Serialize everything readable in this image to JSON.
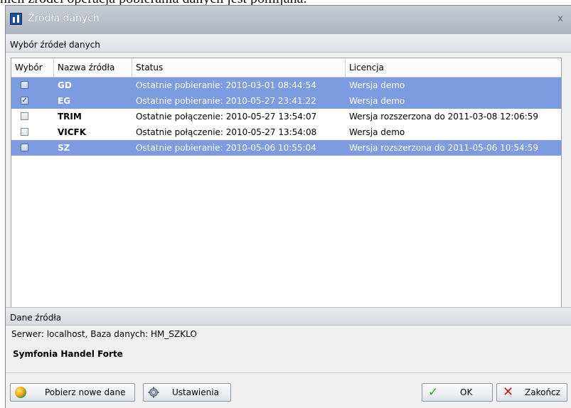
{
  "background_caption": "nich źródeł operacja pobierania danych jest pomijana.",
  "window": {
    "title": "Źródła danych",
    "close_glyph": "x"
  },
  "sources_section": {
    "label": "Wybór źródeł danych"
  },
  "table": {
    "columns": [
      "Wybór",
      "Nazwa źródła",
      "Status",
      "Licencja"
    ],
    "rows": [
      {
        "checked": false,
        "selected": true,
        "name": "GD",
        "status": "Ostatnie pobieranie: 2010-03-01 08:44:54",
        "license": "Wersja demo"
      },
      {
        "checked": true,
        "selected": true,
        "name": "EG",
        "status": "Ostatnie pobieranie: 2010-05-27 23:41:22",
        "license": "Wersja demo"
      },
      {
        "checked": false,
        "selected": false,
        "name": "TRIM",
        "status": "Ostatnie połączenie: 2010-05-27 13:54:07",
        "license": "Wersja rozszerzona do 2011-03-08 12:06:59"
      },
      {
        "checked": false,
        "selected": false,
        "name": "VICFK",
        "status": "Ostatnie połączenie: 2010-05-27 13:54:08",
        "license": "Wersja demo"
      },
      {
        "checked": false,
        "selected": true,
        "name": "SZ",
        "status": "Ostatnie pobieranie: 2010-05-06 10:55:04",
        "license": "Wersja rozszerzona do 2011-05-06 10:54:59"
      }
    ]
  },
  "source_details": {
    "label": "Dane źródła",
    "server_text": "Serwer: localhost, Baza danych: HM_SZKLO",
    "program_name": "Symfonia Handel Forte"
  },
  "buttons": {
    "fetch": {
      "label": "Pobierz nowe dane",
      "icon": "globe-icon"
    },
    "settings": {
      "label": "Ustawienia",
      "icon": "gear-icon"
    },
    "ok": {
      "label": "OK",
      "icon": "check-icon"
    },
    "exit": {
      "label": "Zakończ",
      "icon": "x-icon"
    }
  },
  "colors": {
    "selected_row": "#7d9be0",
    "titlebar": "#b8bdc5",
    "check_green": "#3aa42c",
    "exit_red": "#d31818"
  }
}
